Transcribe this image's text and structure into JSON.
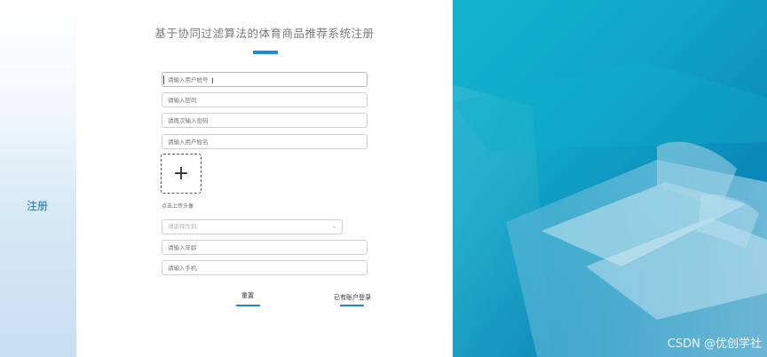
{
  "sidebar": {
    "register_label": "注册"
  },
  "form": {
    "title": "基于协同过滤算法的体育商品推荐系统注册",
    "fields": {
      "username": {
        "placeholder": "请输入用户帐号"
      },
      "password": {
        "placeholder": "请输入密码"
      },
      "confirm_password": {
        "placeholder": "请再次输入密码"
      },
      "name": {
        "placeholder": "请输入用户姓名"
      },
      "gender": {
        "placeholder": "请选择性别"
      },
      "age": {
        "placeholder": "请输入年龄"
      },
      "phone": {
        "placeholder": "请输入手机"
      }
    },
    "upload_hint": "点击上传头像",
    "reset_label": "重置",
    "login_link_label": "已有账户登录"
  },
  "watermark": "CSDN @优创学社",
  "colors": {
    "accent": "#1b8dd6",
    "sidebar_text": "#1d6fb3",
    "hero_bg": "#12b3cf"
  }
}
